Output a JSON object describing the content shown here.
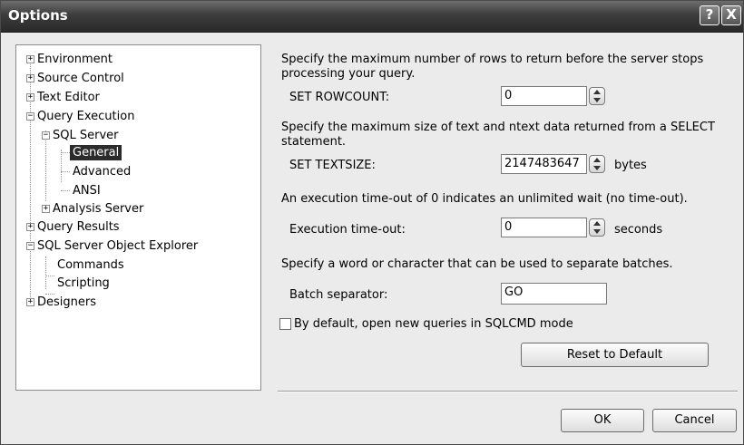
{
  "window": {
    "title": "Options",
    "help_label": "?",
    "close_label": "X"
  },
  "tree": {
    "environment": "Environment",
    "source_control": "Source Control",
    "text_editor": "Text Editor",
    "query_execution": "Query Execution",
    "sql_server": "SQL Server",
    "general": "General",
    "advanced": "Advanced",
    "ansi": "ANSI",
    "analysis_server": "Analysis Server",
    "query_results": "Query Results",
    "object_explorer": "SQL Server Object Explorer",
    "commands": "Commands",
    "scripting": "Scripting",
    "designers": "Designers",
    "plus": "+",
    "minus": "−"
  },
  "settings": {
    "rowcount_desc": "Specify the maximum number of rows to return before the server stops processing your query.",
    "rowcount_label": "SET ROWCOUNT:",
    "rowcount_value": "0",
    "textsize_desc": "Specify the maximum size of text and ntext data returned from a SELECT statement.",
    "textsize_label": "SET TEXTSIZE:",
    "textsize_value": "2147483647",
    "textsize_unit": "bytes",
    "timeout_desc": "An execution time-out of 0 indicates an unlimited wait (no time-out).",
    "timeout_label": "Execution time-out:",
    "timeout_value": "0",
    "timeout_unit": "seconds",
    "batch_desc": "Specify a word or character that can be used to separate batches.",
    "batch_label": "Batch separator:",
    "batch_value": "GO",
    "sqlcmd_label": "By default, open new queries in SQLCMD mode",
    "sqlcmd_checked": false,
    "reset_label": "Reset to Default"
  },
  "footer": {
    "ok_label": "OK",
    "cancel_label": "Cancel"
  }
}
